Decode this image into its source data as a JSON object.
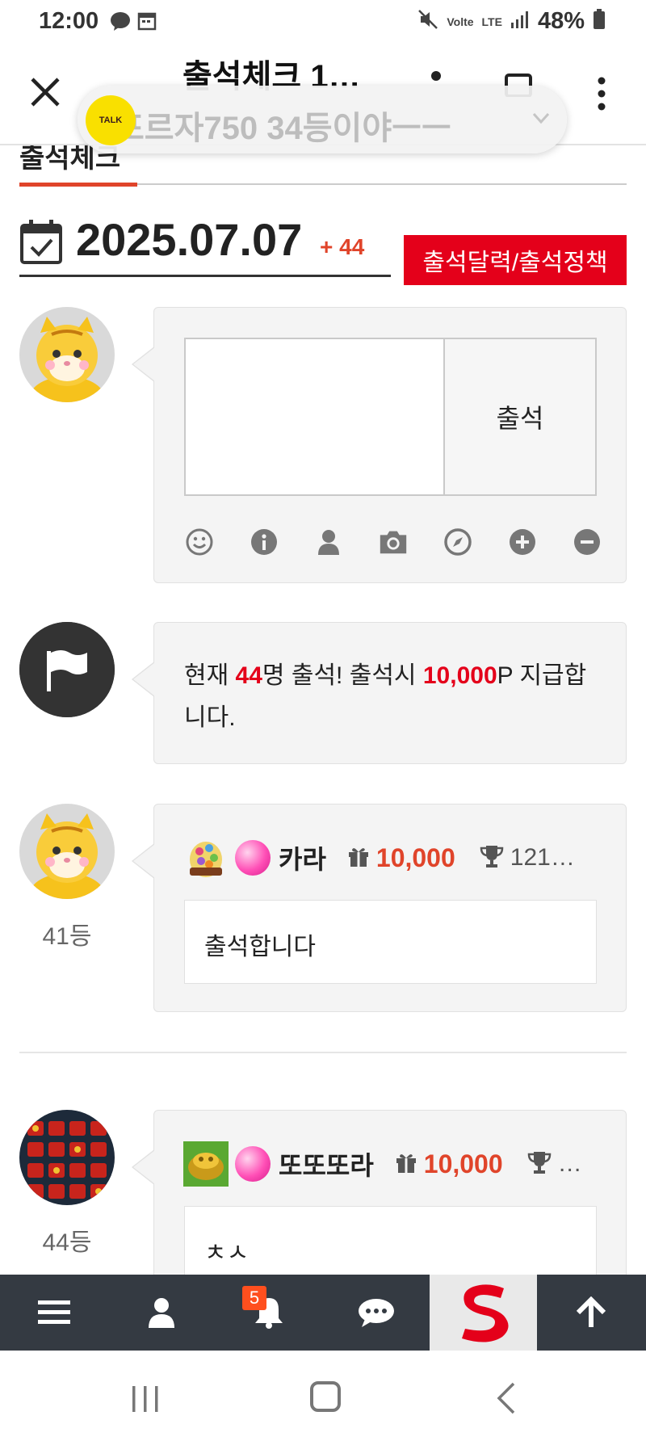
{
  "status_bar": {
    "time": "12:00",
    "network": "LTE",
    "volte": "Volte",
    "battery": "48%",
    "icons": [
      "talk-notification-icon",
      "calendar-icon",
      "mute-icon",
      "signal-icon",
      "battery-icon"
    ]
  },
  "app_bar": {
    "title": "출석체크 1…",
    "close_icon": "close-icon",
    "more_icon": "more-vertical-icon"
  },
  "tab": {
    "active_label": "출석체크"
  },
  "kakao_overlay": {
    "logo_text": "TALK",
    "message": "포르자750 34등이야ㅡㅡ",
    "chevron_icon": "chevron-down-icon"
  },
  "date_row": {
    "date": "2025.07.07",
    "count": "+ 44",
    "policy_button": "출석달력/출석정책"
  },
  "compose": {
    "textarea_placeholder": "",
    "submit_label": "출석",
    "toolbar_icons": [
      "smile-icon",
      "info-icon",
      "user-icon",
      "camera-icon",
      "compass-icon",
      "plus-circle-icon",
      "minus-circle-icon"
    ]
  },
  "notice": {
    "prefix": "현재 ",
    "count": "44",
    "mid": "명 출석! 출석시 ",
    "points": "10,000",
    "suffix": "P 지급합니다."
  },
  "entries": [
    {
      "rank": "41등",
      "nickname": "카라",
      "points": "10,000",
      "total_rank": "121…",
      "message": "출석합니다"
    },
    {
      "rank": "44등",
      "nickname": "또또또라",
      "points": "10,000",
      "total_rank": "…",
      "message": "ㅊㅅ"
    }
  ],
  "bottom_nav": {
    "badge_count": "5",
    "items": [
      "menu-icon",
      "user-icon",
      "bell-icon",
      "chat-icon",
      "site-logo",
      "arrow-up-icon"
    ]
  },
  "system_nav": [
    "recent-apps-icon",
    "home-icon",
    "back-icon"
  ]
}
